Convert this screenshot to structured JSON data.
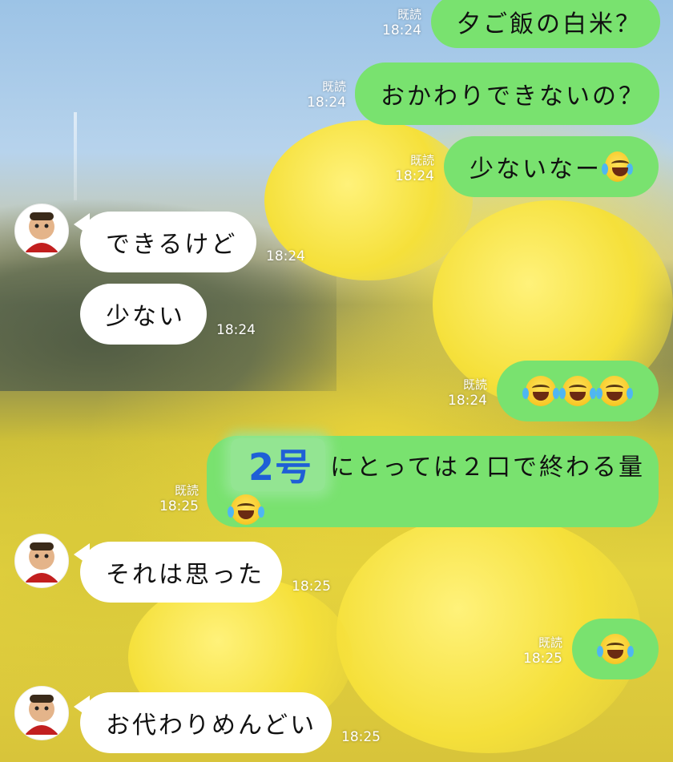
{
  "messages": [
    {
      "id": "m1",
      "side": "out",
      "text": "夕ご飯の白米？",
      "read": "既読",
      "time": "18:24"
    },
    {
      "id": "m2",
      "side": "out",
      "text": "おかわりできないの？",
      "read": "既読",
      "time": "18:24"
    },
    {
      "id": "m3",
      "side": "out",
      "text": "少ないなー",
      "read": "既読",
      "time": "18:24",
      "emoji": "laughing-crying-emoji"
    },
    {
      "id": "m4",
      "side": "in",
      "text": "できるけど",
      "time": "18:24"
    },
    {
      "id": "m5",
      "side": "in",
      "text": "少ない",
      "time": "18:24"
    },
    {
      "id": "m6",
      "side": "out",
      "text": "",
      "read": "既読",
      "time": "18:24",
      "emoji_count": 3
    },
    {
      "id": "m7",
      "side": "out",
      "highlight": "2号",
      "text": "にとっては２口で終わる量",
      "read": "既読",
      "time": "18:25",
      "emoji": "laughing-crying-emoji"
    },
    {
      "id": "m8",
      "side": "in",
      "text": "それは思った",
      "time": "18:25"
    },
    {
      "id": "m9",
      "side": "out",
      "text": "",
      "read": "既読",
      "time": "18:25",
      "emoji_count": 1
    },
    {
      "id": "m10",
      "side": "in",
      "text": "お代わりめんどい",
      "time": "18:25"
    }
  ],
  "colors": {
    "outgoing_bubble": "#79e26f",
    "incoming_bubble": "#ffffff",
    "highlight_text": "#1f5fd6"
  }
}
